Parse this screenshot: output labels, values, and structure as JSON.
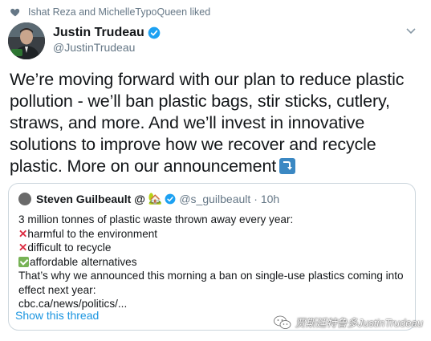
{
  "social_context": {
    "text": "Ishat Reza and MichelleTypoQueen liked",
    "icon": "heart-icon"
  },
  "author": {
    "name": "Justin Trudeau",
    "handle": "@JustinTrudeau",
    "verified": true
  },
  "tweet": {
    "text": "We’re moving forward with our plan to reduce plastic pollution - we’ll ban plastic bags, stir sticks, cutlery, straws, and more. And we’ll invest in innovative solutions to improve how we recover and recycle plastic. More on our announcement",
    "trailing_emoji": "right-arrow-curving-down-icon"
  },
  "quoted_tweet": {
    "name": "Steven Guilbeault",
    "name_suffix": "@",
    "name_emoji": "🏡",
    "handle": "@s_guilbeault",
    "time": "· 10h",
    "lines": [
      {
        "text": "3 million tonnes of plastic waste thrown away every year:"
      },
      {
        "mark": "x",
        "text": "harmful to the environment"
      },
      {
        "mark": "x",
        "text": "difficult to recycle"
      },
      {
        "mark": "check",
        "text": "affordable alternatives"
      },
      {
        "text": "That’s why we announced this morning a ban on single-use plastics coming into"
      },
      {
        "text": "effect next year:"
      },
      {
        "text": "cbc.ca/news/politics/..."
      }
    ],
    "show_thread": "Show this thread"
  },
  "watermark": {
    "text": "贾斯廷特鲁多JustinTrudeau"
  },
  "colors": {
    "link": "#1b95e0",
    "verified": "#1da1f2",
    "muted": "#657786",
    "border": "#ccd6dd"
  }
}
